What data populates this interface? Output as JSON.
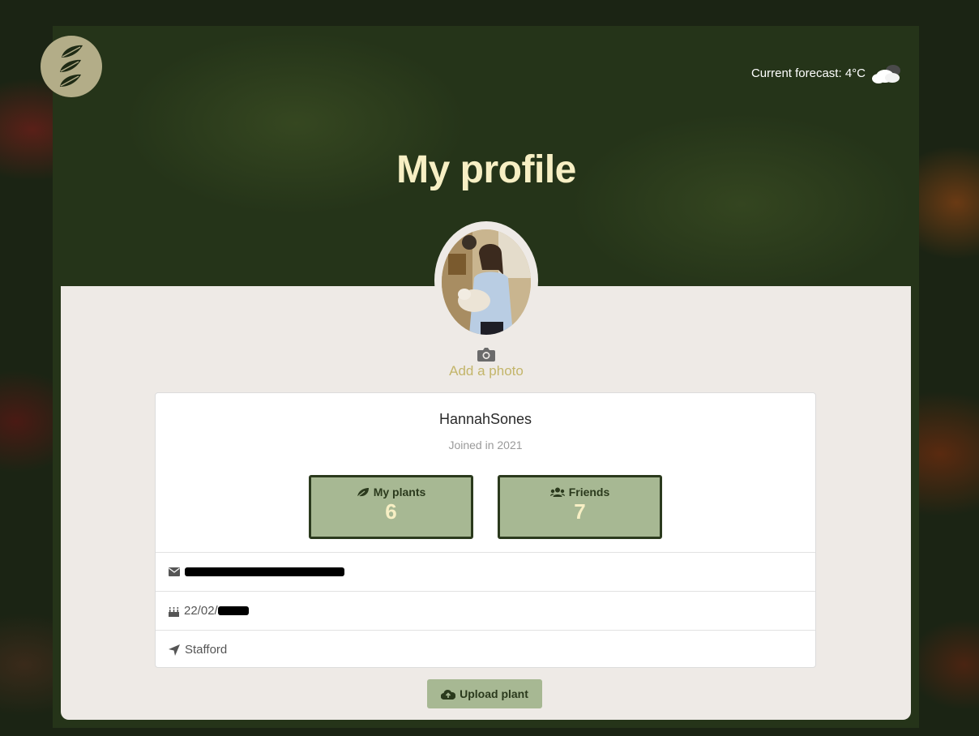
{
  "header": {
    "forecast_text": "Current forecast: 4°C",
    "weather_icon": "cloud-icon",
    "logo_icon": "leaf-icon"
  },
  "page_title": "My profile",
  "profile": {
    "add_photo_label": "Add a photo",
    "username": "HannahSones",
    "joined": "Joined in 2021",
    "stats": [
      {
        "label": "My plants",
        "value": "6",
        "icon": "leaf-icon"
      },
      {
        "label": "Friends",
        "value": "7",
        "icon": "users-icon"
      }
    ],
    "details": {
      "email_icon": "envelope-icon",
      "birthday_prefix": "22/02/",
      "birthday_icon": "cake-icon",
      "location": "Stafford",
      "location_icon": "location-arrow-icon"
    }
  },
  "actions": {
    "upload_label": "Upload plant",
    "upload_icon": "cloud-upload-icon"
  },
  "colors": {
    "accent": "#a7b893",
    "title": "#f7efc4",
    "dark_green": "#253419",
    "link_gold": "#c3b56a"
  }
}
